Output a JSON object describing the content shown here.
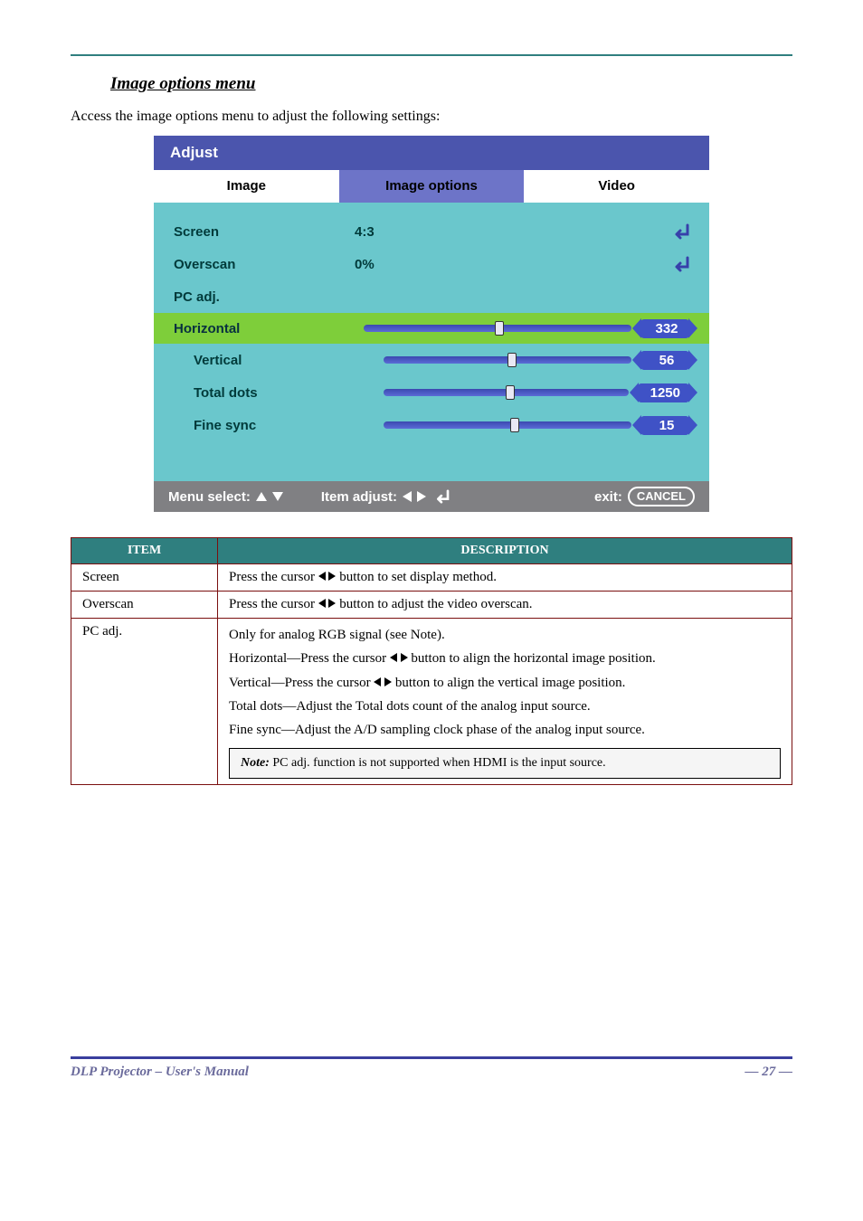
{
  "section": {
    "title": "Image options menu",
    "lead": "Access the image options menu to adjust the following settings:"
  },
  "osd": {
    "title": "Adjust",
    "tabs": [
      "Image",
      "Image options",
      "Video"
    ],
    "rows": {
      "screen": {
        "label": "Screen",
        "value": "4:3"
      },
      "overscan": {
        "label": "Overscan",
        "value": "0%"
      },
      "pcadj": {
        "label": "PC adj."
      }
    },
    "sliders": {
      "horizontal": {
        "label": "Horizontal",
        "value": "332",
        "pos": 49
      },
      "vertical": {
        "label": "Vertical",
        "value": "56",
        "pos": 50
      },
      "totaldots": {
        "label": "Total dots",
        "value": "1250",
        "pos": 50
      },
      "finesync": {
        "label": "Fine sync",
        "value": "15",
        "pos": 51
      }
    },
    "footer": {
      "menuSelect": "Menu select:",
      "itemAdjust": "Item adjust:",
      "exit": "exit:",
      "cancel": "CANCEL"
    }
  },
  "table": {
    "headers": {
      "item": "ITEM",
      "desc": "DESCRIPTION"
    },
    "screen": {
      "item": "Screen",
      "desc_a": "Press the cursor ",
      "desc_b": " button to set display method."
    },
    "overscan": {
      "item": "Overscan",
      "desc_a": "Press the cursor ",
      "desc_b": " button to adjust the video overscan."
    },
    "pcadj": {
      "item": "PC adj.",
      "intro": "Only for analog RGB signal (see Note).",
      "horiz_a": "Horizontal—Press the cursor ",
      "horiz_b": " button to align the horizontal image position.",
      "vert_a": "Vertical—Press the cursor ",
      "vert_b": " button to align the vertical image position.",
      "totaldots": "Total dots—Adjust the Total dots count of the analog input source.",
      "finesync": "Fine sync—Adjust the A/D sampling clock phase of the analog input source.",
      "note_label": "Note:",
      "note_body": " PC adj. function is not supported when HDMI is the input source."
    }
  },
  "page_footer": {
    "left": "DLP Projector – User's Manual",
    "right": "— 27 —"
  }
}
